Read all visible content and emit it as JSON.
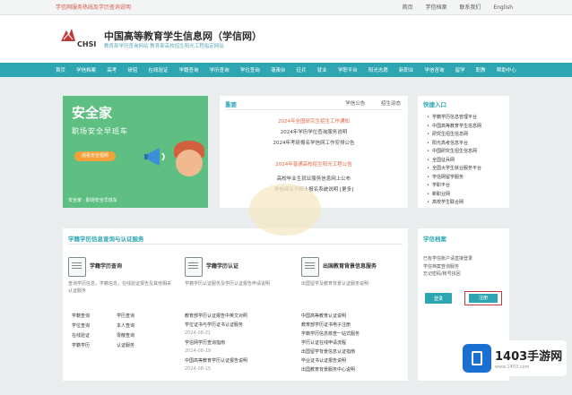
{
  "topbar": {
    "notice": "学信网服务热线及学历查询说明",
    "links": [
      "首页",
      "学信档案",
      "联系我们",
      "English"
    ]
  },
  "header": {
    "logo_text": "CHSI",
    "title": "中国高等教育学生信息网（学信网）",
    "subtitle": "教育部学历查询网站 教育部高校招生阳光工程指定网站"
  },
  "nav": {
    "items": [
      "首页",
      "学信档案",
      "高考",
      "研招",
      "在线验证",
      "学籍查询",
      "学历查询",
      "学位查询",
      "港澳台",
      "征兵",
      "就业",
      "学职平台",
      "阳光志愿",
      "新职业",
      "学信咨询",
      "留学",
      "职教",
      "帮助中心"
    ]
  },
  "banner": {
    "title": "安全家",
    "subtitle": "职场安全早班车",
    "cta": "观看安全视频",
    "caption": "安全家 · 职场安全早班车"
  },
  "news": {
    "heading": "重要",
    "tabs": [
      "学信公告",
      "招生动态"
    ],
    "items": [
      {
        "text": "2024年全国研究生招生工作通知",
        "color": "#e06840"
      },
      {
        "text": "2024年学历学位查询服务说明",
        "color": "#444444"
      },
      {
        "text": "2024年考研报名学信网工作安排公告",
        "color": "#444444"
      },
      {
        "text": "2024年普通高校招生阳光工程公告",
        "color": "#e06840"
      },
      {
        "text": "高校毕业生就业服务信息网上公布",
        "color": "#444444"
      },
      {
        "text": "学信网关于网上报名系统说明  [更多]",
        "color": "#444444"
      }
    ]
  },
  "quick_links": {
    "heading": "快捷入口",
    "items": [
      "学籍学历信息管理平台",
      "中国高等教育学生信息网",
      "研究生招生信息网",
      "阳光高考信息平台",
      "中国研究生招生信息网",
      "全国征兵网",
      "全国大学生就业服务平台",
      "学信网留学服务",
      "学职平台",
      "新职业网",
      "高校学生联合网"
    ]
  },
  "services": {
    "heading": "学籍学历信息查询与认证服务",
    "columns": [
      {
        "title": "学籍学历查询",
        "desc": "查询学历信息，学籍信息，在线验证报告及其他相关认证服务",
        "grid": [
          "学籍查询",
          "学历查询",
          "学位查询",
          "本人查询",
          "在线验证",
          "零散查询",
          "学籍学历",
          "认证服务"
        ]
      },
      {
        "title": "学籍学历认证",
        "desc": "学籍学历认证服务及学历认证报告申请说明",
        "list": [
          {
            "text": "教育部学历认证报告中英文对照",
            "sub": false
          },
          {
            "text": "学位证书与学历证书认证服务",
            "sub": false
          },
          {
            "text": "2024-08-21",
            "sub": true
          },
          {
            "text": "学信网学历查询指南",
            "sub": false
          },
          {
            "text": "2024-08-19",
            "sub": true
          },
          {
            "text": "中国高等教育学历认证报告说明",
            "sub": false
          },
          {
            "text": "2024-08-15",
            "sub": true
          }
        ]
      },
      {
        "title": "出国教育背景信息服务",
        "desc": "出国留学及教育背景认证服务说明",
        "list": [
          {
            "text": "中国高等教育认证说明",
            "sub": false
          },
          {
            "text": "教育部学历证书电子注册",
            "sub": false
          },
          {
            "text": "学籍学历信息核查一站式服务",
            "sub": false
          },
          {
            "text": "学历认证在线申请流程",
            "sub": false
          },
          {
            "text": "出国留学背景信息认证指南",
            "sub": false
          },
          {
            "text": "毕业证书认证报告说明",
            "sub": false
          },
          {
            "text": "出国教育背景服务中心说明",
            "sub": false
          }
        ]
      }
    ]
  },
  "login": {
    "heading": "学信档案",
    "text_lines": [
      "已有学信账户请直接登录",
      "学信档案查询服务",
      "忘记密码/账号找回"
    ],
    "login_label": "登录",
    "register_label": "注册"
  },
  "watermark": {
    "text": "1403手游网",
    "sub": "www.1403.com"
  }
}
